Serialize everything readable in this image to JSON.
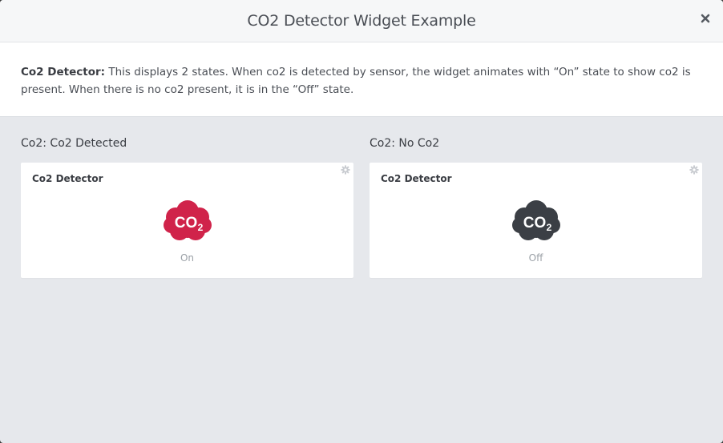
{
  "dialog": {
    "title": "CO2 Detector Widget Example"
  },
  "description": {
    "label": "Co2 Detector:",
    "text": " This displays 2 states. When co2 is detected by sensor, the widget animates with “On” state to show co2 is present. When there is no co2 present, it is in the “Off” state."
  },
  "examples": [
    {
      "heading": "Co2: Co2 Detected",
      "card_title": "Co2 Detector",
      "state": "On",
      "icon": "co2-cloud-icon",
      "color": "#d0234a"
    },
    {
      "heading": "Co2: No Co2",
      "card_title": "Co2 Detector",
      "state": "Off",
      "icon": "co2-cloud-icon",
      "color": "#3b3f45"
    }
  ]
}
